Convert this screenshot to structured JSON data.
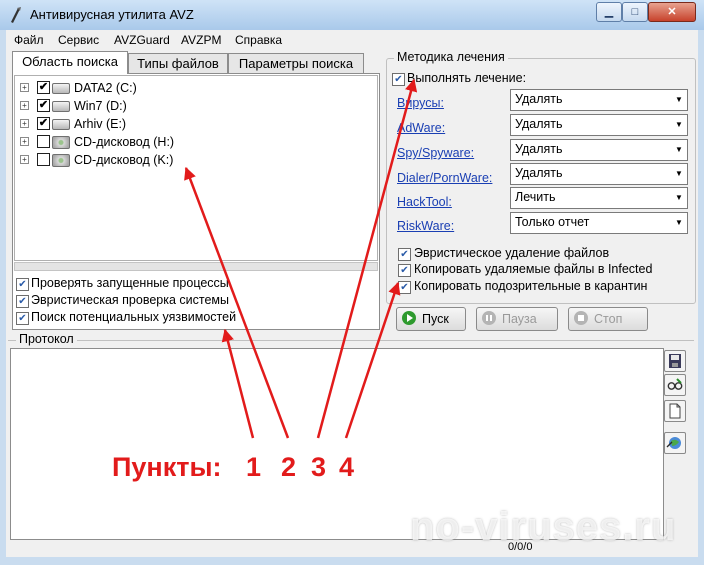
{
  "window": {
    "title": "Антивирусная утилита AVZ",
    "buttons": {
      "minimize": "▁",
      "maximize": "□",
      "close": "✕"
    }
  },
  "menu": [
    "Файл",
    "Сервис",
    "AVZGuard",
    "AVZPM",
    "Справка"
  ],
  "tabs": [
    "Область поиска",
    "Типы файлов",
    "Параметры поиска"
  ],
  "drives": [
    {
      "label": "DATA2 (C:)",
      "checked": "✔"
    },
    {
      "label": "Win7 (D:)",
      "checked": "✔"
    },
    {
      "label": "Arhiv (E:)",
      "checked": "✔"
    },
    {
      "label": "CD-дисковод (H:)",
      "checked": ""
    },
    {
      "label": "CD-дисковод (K:)",
      "checked": ""
    }
  ],
  "scan_options": [
    "Проверять запущенные процессы",
    "Эвристическая проверка системы",
    "Поиск потенциальных уязвимостей"
  ],
  "treatment": {
    "group_title": "Методика лечения",
    "perform_treatment": "Выполнять лечение:",
    "rows": [
      {
        "threat": "Вирусы:",
        "action": "Удалять"
      },
      {
        "threat": "AdWare:",
        "action": "Удалять"
      },
      {
        "threat": "Spy/Spyware:",
        "action": "Удалять"
      },
      {
        "threat": "Dialer/PornWare:",
        "action": "Удалять"
      },
      {
        "threat": "HackTool:",
        "action": "Лечить"
      },
      {
        "threat": "RiskWare:",
        "action": "Только отчет"
      }
    ],
    "extra_options": [
      "Эвристическое удаление файлов",
      "Копировать удаляемые файлы в  Infected",
      "Копировать подозрительные в  карантин"
    ]
  },
  "buttons": {
    "start": "Пуск",
    "pause": "Пауза",
    "stop": "Стоп"
  },
  "protocol": {
    "title": "Протокол",
    "status": "0/0/0"
  },
  "annotation": {
    "label": "Пункты:",
    "numbers": [
      "1",
      "2",
      "3",
      "4"
    ]
  },
  "watermark": "no-viruses.ru",
  "colors": {
    "annotation": "#e21b1b",
    "link": "#1a3fb3",
    "titlebar": "#bcd4ee"
  }
}
